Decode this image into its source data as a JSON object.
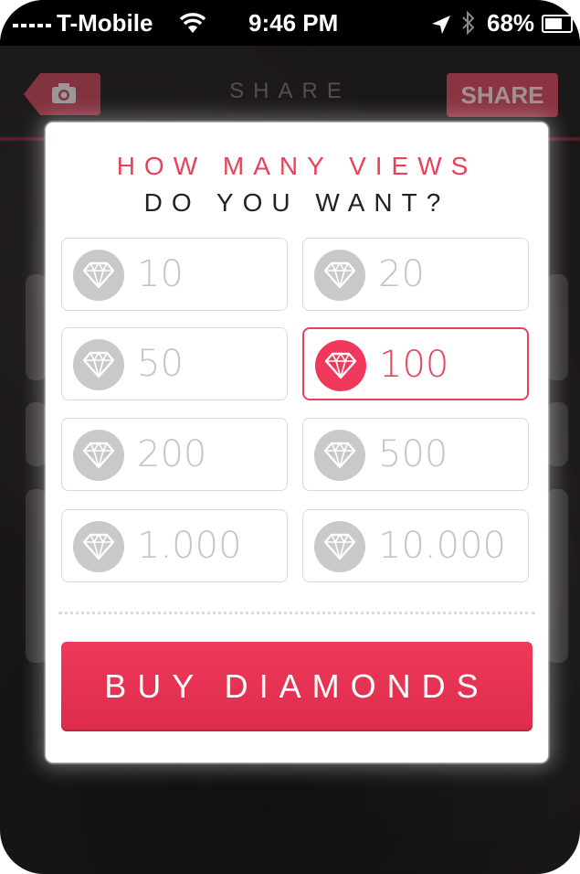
{
  "status_bar": {
    "carrier": "T-Mobile",
    "time": "9:46 PM",
    "battery": "68%",
    "battery_level": 0.68,
    "icons": [
      "signal-icon",
      "wifi-icon",
      "location-icon",
      "bluetooth-icon",
      "battery-icon"
    ]
  },
  "navbar": {
    "title": "SHARE",
    "share_label": "SHARE",
    "back_icon": "camera-icon"
  },
  "modal": {
    "title_line1": "HOW MANY VIEWS",
    "title_line2": "DO YOU WANT?",
    "accent_color": "#e8425a",
    "options": [
      {
        "value": "10",
        "selected": false
      },
      {
        "value": "20",
        "selected": false
      },
      {
        "value": "50",
        "selected": false
      },
      {
        "value": "100",
        "selected": true
      },
      {
        "value": "200",
        "selected": false
      },
      {
        "value": "500",
        "selected": false
      },
      {
        "value": "1.000",
        "selected": false
      },
      {
        "value": "10.000",
        "selected": false
      }
    ],
    "option_icon": "diamond-icon",
    "buy_label": "BUY DIAMONDS"
  }
}
